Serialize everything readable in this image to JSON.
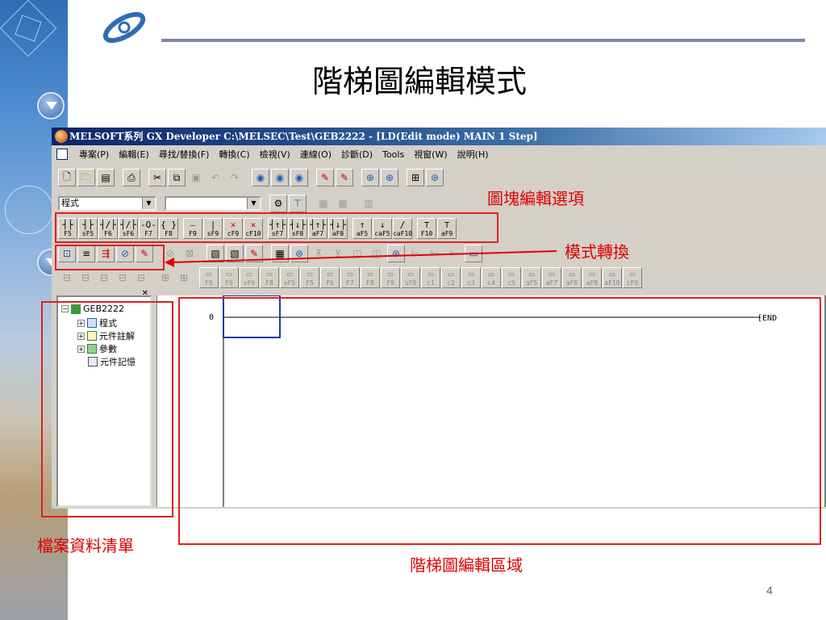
{
  "slide": {
    "title": "階梯圖編輯模式",
    "page_number": "4"
  },
  "window": {
    "title": "MELSOFT系列 GX Developer C:\\MELSEC\\Test\\GEB2222 - [LD(Edit mode)    MAIN    1 Step]"
  },
  "menu": [
    "專案(P)",
    "編輯(E)",
    "尋找/替換(F)",
    "轉換(C)",
    "檢視(V)",
    "連線(O)",
    "診斷(D)",
    "Tools",
    "視窗(W)",
    "說明(H)"
  ],
  "toolbar2": {
    "program_combo": "程式",
    "device_combo": ""
  },
  "ladder_keys": [
    {
      "sym": "┤├",
      "key": "F5"
    },
    {
      "sym": "┤├",
      "key": "sF5"
    },
    {
      "sym": "┤/├",
      "key": "F6"
    },
    {
      "sym": "┤/├",
      "key": "sF6"
    },
    {
      "sym": "-O-",
      "key": "F7"
    },
    {
      "sym": "{ }",
      "key": "F8"
    },
    {
      "sym": "—",
      "key": "F9"
    },
    {
      "sym": "|",
      "key": "sF9"
    },
    {
      "sym": "✕",
      "key": "cF9"
    },
    {
      "sym": "✕",
      "key": "cF10"
    },
    {
      "sym": "┤↑├",
      "key": "sF7"
    },
    {
      "sym": "┤↓├",
      "key": "sF8"
    },
    {
      "sym": "┤↑├",
      "key": "aF7"
    },
    {
      "sym": "┤↓├",
      "key": "aF8"
    },
    {
      "sym": "↑",
      "key": "aF5"
    },
    {
      "sym": "↓",
      "key": "caF5"
    },
    {
      "sym": "∕",
      "key": "caF10"
    },
    {
      "sym": "⊤",
      "key": "F10"
    },
    {
      "sym": "⊤",
      "key": "aF9"
    }
  ],
  "ladder_keys_disabled": [
    "F5",
    "F6",
    "sF6",
    "F8",
    "sF5",
    "F5",
    "F6",
    "F7",
    "F8",
    "F9",
    "sF9",
    "c1",
    "c2",
    "c3",
    "c4",
    "c5",
    "aF5",
    "aF7",
    "aF8",
    "aF9",
    "aF10",
    "cF9"
  ],
  "tree": {
    "project": "GEB2222",
    "items": [
      "程式",
      "元件註解",
      "參數",
      "元件記憶"
    ]
  },
  "ladder": {
    "step": "0",
    "end_label": "END"
  },
  "annotations": {
    "block_edit": "圖塊編輯選項",
    "mode_switch": "模式轉換",
    "file_list": "檔案資料清單",
    "ladder_area": "階梯圖編輯區域"
  },
  "colors": {
    "annotation_red": "#e00000",
    "title_bar": "#0a246a",
    "cursor_blue": "#1a3aa8"
  }
}
